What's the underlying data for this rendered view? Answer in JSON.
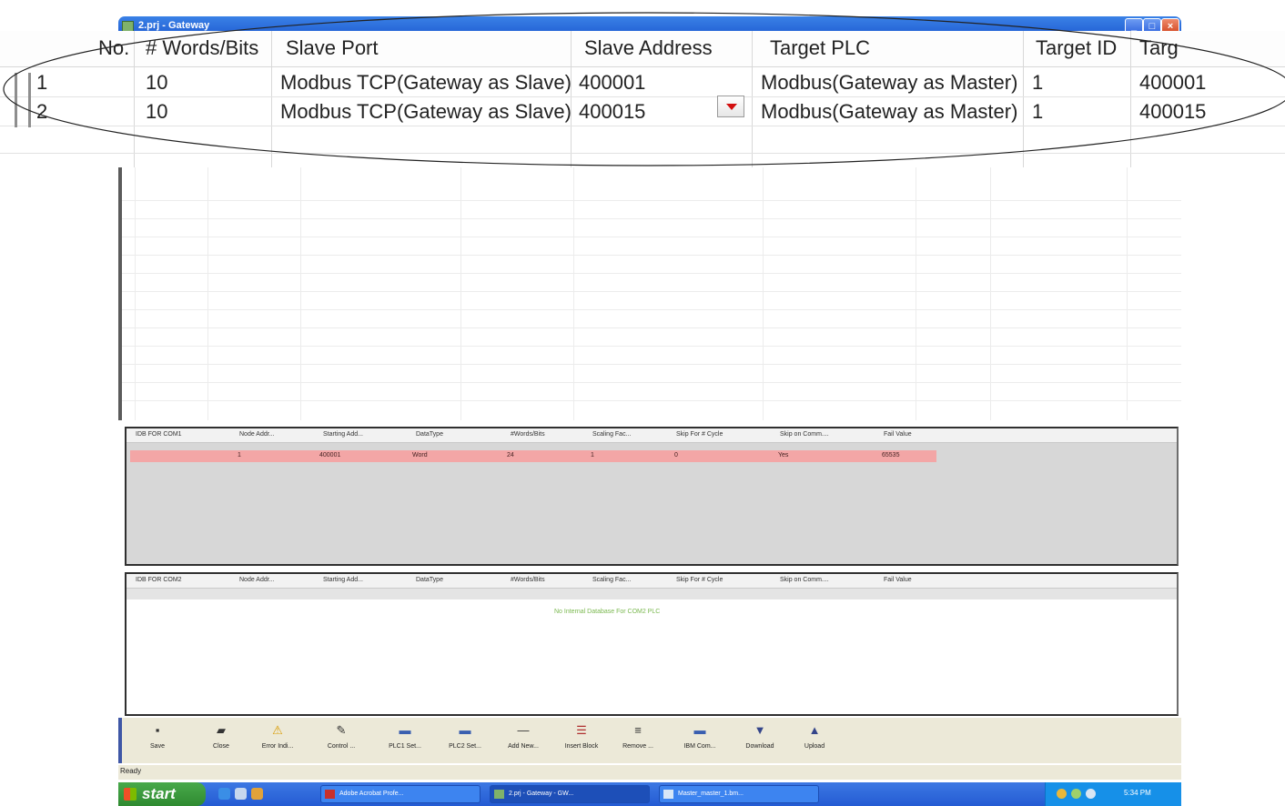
{
  "window": {
    "title": "2.prj - Gateway"
  },
  "zoomed_grid": {
    "headers": [
      "No.",
      "# Words/Bits",
      "Slave Port",
      "Slave Address",
      "Target PLC",
      "Target ID",
      "Targ"
    ],
    "rows": [
      {
        "no": "1",
        "words": "10",
        "slave_port": "Modbus TCP(Gateway as Slave)",
        "slave_address": "400001",
        "target_plc": "Modbus(Gateway as Master)",
        "target_id": "1",
        "target_addr": "400001"
      },
      {
        "no": "2",
        "words": "10",
        "slave_port": "Modbus TCP(Gateway as Slave)",
        "slave_address": "400015",
        "target_plc": "Modbus(Gateway as Master)",
        "target_id": "1",
        "target_addr": "400015"
      }
    ]
  },
  "panel1": {
    "headers": [
      "IDB FOR COM1",
      "Node Addr...",
      "Starting Add...",
      "DataType",
      "#Words/Bits",
      "Scaling Fac...",
      "Skip For # Cycle",
      "Skip on Comm....",
      "Fail Value"
    ],
    "row": [
      "",
      "1",
      "400001",
      "Word",
      "24",
      "1",
      "0",
      "Yes",
      "65535"
    ]
  },
  "panel2": {
    "headers": [
      "IDB FOR COM2",
      "Node Addr...",
      "Starting Add...",
      "DataType",
      "#Words/Bits",
      "Scaling Fac...",
      "Skip For # Cycle",
      "Skip on Comm....",
      "Fail Value"
    ],
    "message": "No Internal Database For COM2 PLC"
  },
  "toolbar": {
    "buttons": [
      {
        "label": "Save",
        "icon": "floppy-icon"
      },
      {
        "label": "Close",
        "icon": "folder-icon"
      },
      {
        "label": "Error Indi...",
        "icon": "warning-icon"
      },
      {
        "label": "Control ...",
        "icon": "wrench-icon"
      },
      {
        "label": "PLC1 Set...",
        "icon": "plc-icon"
      },
      {
        "label": "PLC2 Set...",
        "icon": "plc-icon"
      },
      {
        "label": "Add New...",
        "icon": "add-line-icon"
      },
      {
        "label": "Insert Block",
        "icon": "insert-block-icon"
      },
      {
        "label": "Remove ...",
        "icon": "remove-icon"
      },
      {
        "label": "IBM Com...",
        "icon": "comm-icon"
      },
      {
        "label": "Download",
        "icon": "download-icon"
      },
      {
        "label": "Upload",
        "icon": "upload-icon"
      }
    ]
  },
  "status": {
    "text": "Ready"
  },
  "taskbar": {
    "start_label": "start",
    "tasks": [
      "Adobe Acrobat Profe...",
      "2.prj - Gateway - GW...",
      "Master_master_1.bm..."
    ],
    "clock": "5:34 PM"
  },
  "colors": {
    "highlight_row": "#f3a6a6",
    "titlebar": "#2a64d8",
    "taskbar": "#2b61d8",
    "start": "#3b9a3d",
    "dropdown_arrow": "#d30f0f"
  }
}
